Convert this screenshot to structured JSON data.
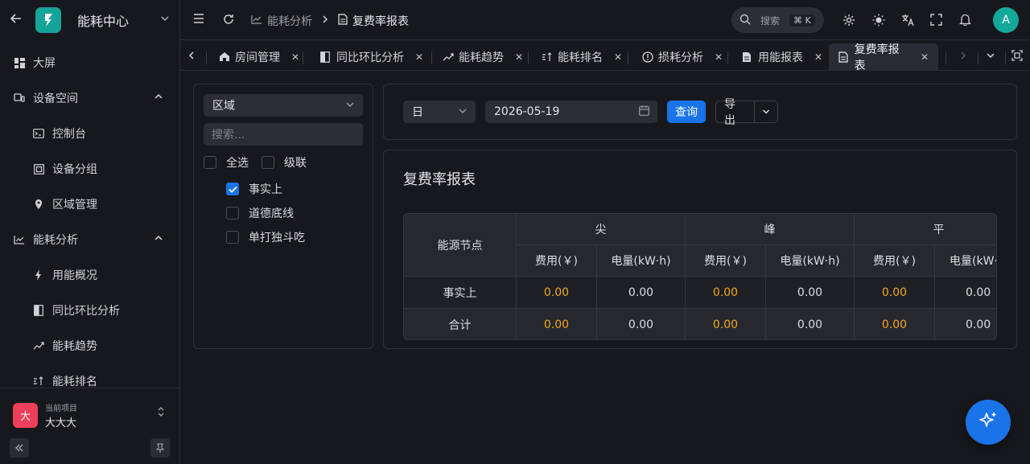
{
  "sidebar": {
    "app_title": "能耗中心",
    "items": [
      {
        "label": "大屏"
      },
      {
        "label": "设备空间"
      },
      {
        "label": "控制台"
      },
      {
        "label": "设备分组"
      },
      {
        "label": "区域管理"
      },
      {
        "label": "能耗分析"
      },
      {
        "label": "用能概况"
      },
      {
        "label": "同比环比分析"
      },
      {
        "label": "能耗趋势"
      },
      {
        "label": "能耗排名"
      }
    ],
    "project": {
      "caption": "当前项目",
      "name": "大大大",
      "avatar": "大"
    }
  },
  "header": {
    "breadcrumb": [
      "能耗分析",
      "复费率报表"
    ],
    "search_placeholder": "搜索",
    "search_shortcut": "⌘ K",
    "avatar": "A"
  },
  "tabs": [
    {
      "label": "房间管理"
    },
    {
      "label": "同比环比分析"
    },
    {
      "label": "能耗趋势"
    },
    {
      "label": "能耗排名"
    },
    {
      "label": "损耗分析"
    },
    {
      "label": "用能报表"
    },
    {
      "label": "复费率报表"
    }
  ],
  "filter": {
    "dimension": "区域",
    "search_placeholder": "搜索...",
    "select_all": "全选",
    "cascade": "级联",
    "nodes": [
      {
        "label": "事实上",
        "checked": true
      },
      {
        "label": "道德底线",
        "checked": false
      },
      {
        "label": "单打独斗吃",
        "checked": false
      }
    ]
  },
  "query": {
    "granularity": "日",
    "date": "2026-05-19",
    "query_label": "查询",
    "export_label": "导出"
  },
  "report": {
    "title": "复费率报表",
    "node_header": "能源节点",
    "groups": [
      "尖",
      "峰",
      "平"
    ],
    "sub_cost": "费用(￥)",
    "sub_energy": "电量(kW·h)",
    "rows": [
      {
        "name": "事实上",
        "values": [
          "0.00",
          "0.00",
          "0.00",
          "0.00",
          "0.00",
          "0.00"
        ]
      },
      {
        "name": "合计",
        "values": [
          "0.00",
          "0.00",
          "0.00",
          "0.00",
          "0.00",
          "0.00"
        ]
      }
    ]
  },
  "colors": {
    "accent": "#1a73e8",
    "cost": "#f5a623",
    "brand": "#15a39a",
    "project_avatar": "#ef3f5a"
  }
}
